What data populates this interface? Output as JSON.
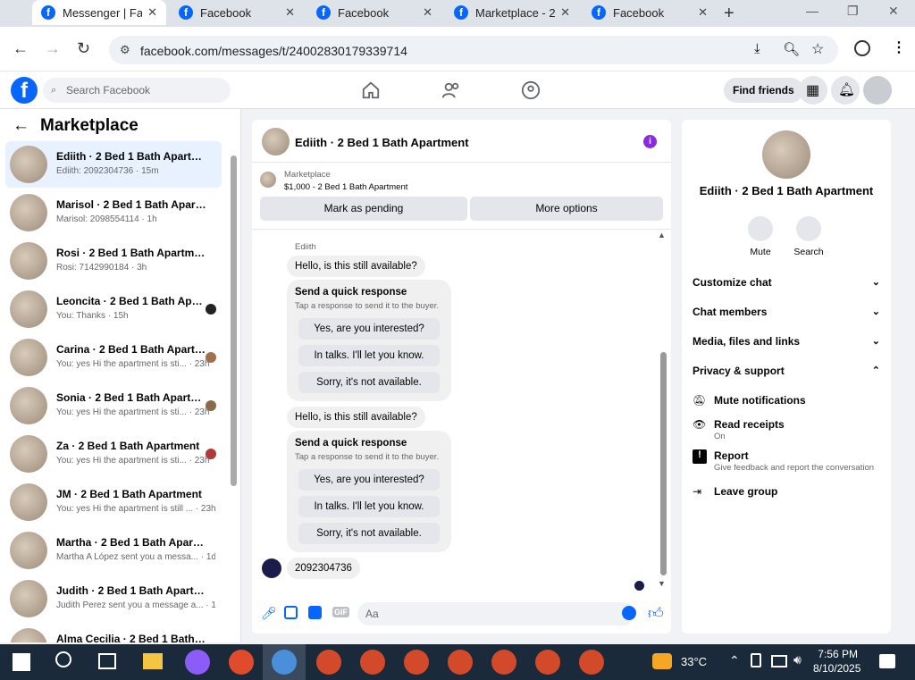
{
  "browser": {
    "tabs": [
      {
        "title": "Messenger | Fa",
        "active": true
      },
      {
        "title": "Facebook",
        "active": false
      },
      {
        "title": "Facebook",
        "active": false
      },
      {
        "title": "Marketplace - 2",
        "active": false
      },
      {
        "title": "Facebook",
        "active": false
      }
    ],
    "url": "facebook.com/messages/t/24002830179339714"
  },
  "fb": {
    "search_placeholder": "Search Facebook",
    "find_friends": "Find friends"
  },
  "left": {
    "title": "Marketplace",
    "conversations": [
      {
        "name": "Ediith · 2 Bed 1 Bath Apartment",
        "snippet": "Ediith: 2092304736 · 15m",
        "selected": true
      },
      {
        "name": "Marisol · 2 Bed 1 Bath Apartment",
        "snippet": "Marisol: 2098554114 · 1h"
      },
      {
        "name": "Rosi · 2 Bed 1 Bath Apartment",
        "snippet": "Rosi: 7142990184 · 3h"
      },
      {
        "name": "Leoncita · 2 Bed 1 Bath Apart...",
        "snippet": "You: Thanks · 15h"
      },
      {
        "name": "Carina · 2 Bed 1 Bath Apartm...",
        "snippet": "You: yes Hi the apartment is sti... · 23h"
      },
      {
        "name": "Sonia · 2 Bed 1 Bath Apartment",
        "snippet": "You: yes Hi the apartment is sti... · 23h"
      },
      {
        "name": "Za · 2 Bed 1 Bath Apartment",
        "snippet": "You: yes Hi the apartment is sti... · 23h"
      },
      {
        "name": "JM · 2 Bed 1 Bath Apartment",
        "snippet": "You: yes Hi the apartment is still ... · 23h"
      },
      {
        "name": "Martha · 2 Bed 1 Bath Apartment",
        "snippet": "Martha A López sent you a messa... · 1d"
      },
      {
        "name": "Judith · 2 Bed 1 Bath Apartment",
        "snippet": "Judith Perez sent you a message a... · 1d"
      },
      {
        "name": "Alma Cecilia · 2 Bed 1 Bath Apar...",
        "snippet": ""
      }
    ]
  },
  "chat": {
    "title": "Ediith · 2 Bed 1 Bath Apartment",
    "mp_label": "Marketplace",
    "mp_listing": "$1,000 - 2 Bed 1 Bath Apartment",
    "btn_pending": "Mark as pending",
    "btn_more": "More options",
    "sender": "Ediith",
    "msg1": "Hello, is this still available?",
    "quick_title": "Send a quick response",
    "quick_sub": "Tap a response to send it to the buyer.",
    "quick_opts": [
      "Yes, are you interested?",
      "In talks. I'll let you know.",
      "Sorry, it's not available."
    ],
    "msg2": "Hello, is this still available?",
    "msg3": "2092304736",
    "compose_placeholder": "Aa"
  },
  "details": {
    "title": "Ediith · 2 Bed 1 Bath Apartment",
    "mute": "Mute",
    "search": "Search",
    "sections": [
      "Customize chat",
      "Chat members",
      "Media, files and links",
      "Privacy & support"
    ],
    "items": [
      {
        "label": "Mute notifications",
        "sub": ""
      },
      {
        "label": "Read receipts",
        "sub": "On"
      },
      {
        "label": "Report",
        "sub": "Give feedback and report the conversation"
      },
      {
        "label": "Leave group",
        "sub": ""
      }
    ]
  },
  "taskbar": {
    "temp": "33°C",
    "time": "7:56 PM",
    "date": "8/10/2025"
  },
  "colors": {
    "fb_blue": "#0866ff",
    "info_purple": "#8a2be2",
    "selected_bg": "#e7f1ff"
  }
}
